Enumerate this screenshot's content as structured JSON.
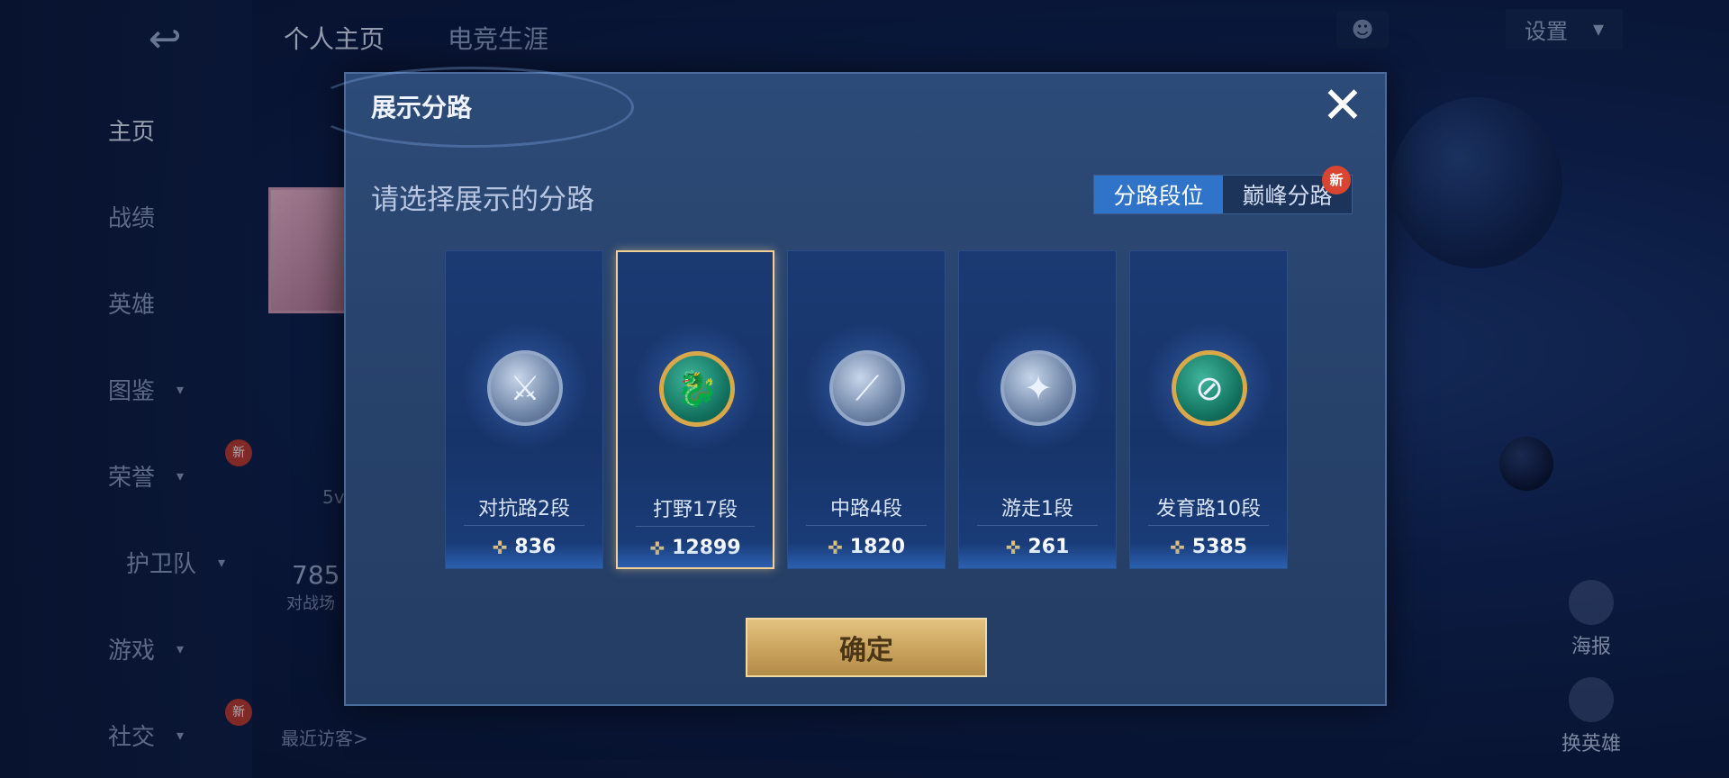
{
  "background": {
    "back_icon": "↩",
    "top_tabs": [
      "个人主页",
      "电竞生涯"
    ],
    "settings_label": "设置",
    "nav": [
      {
        "label": "主页",
        "chevron": false,
        "new": false
      },
      {
        "label": "战绩",
        "chevron": false,
        "new": false
      },
      {
        "label": "英雄",
        "chevron": false,
        "new": false
      },
      {
        "label": "图鉴",
        "chevron": true,
        "new": false
      },
      {
        "label": "荣誉",
        "chevron": true,
        "new": true
      },
      {
        "label": "护卫队",
        "chevron": true,
        "new": false
      },
      {
        "label": "游戏",
        "chevron": true,
        "new": false
      },
      {
        "label": "社交",
        "chevron": true,
        "new": true
      }
    ],
    "new_tag": "新",
    "recent_visitors_label": "最近访客>",
    "partial_number": "785",
    "partial_label": "对战场",
    "partial_small": "5v",
    "side_buttons": [
      "海报",
      "换英雄"
    ]
  },
  "modal": {
    "title": "展示分路",
    "close_icon": "✕",
    "prompt": "请选择展示的分路",
    "toggle": {
      "options": [
        "分路段位",
        "巅峰分路"
      ],
      "active_index": 0,
      "new_tag": "新"
    },
    "cards": [
      {
        "lane": "对抗路2段",
        "score": "836",
        "badge": "crossed-swords-icon",
        "glyph": "⚔",
        "tier": "silver",
        "selected": false
      },
      {
        "lane": "打野17段",
        "score": "12899",
        "badge": "dragon-icon",
        "glyph": "🐉",
        "tier": "gold",
        "selected": true
      },
      {
        "lane": "中路4段",
        "score": "1820",
        "badge": "wand-icon",
        "glyph": "⟋",
        "tier": "silver",
        "selected": false
      },
      {
        "lane": "游走1段",
        "score": "261",
        "badge": "wings-icon",
        "glyph": "✦",
        "tier": "silver",
        "selected": false
      },
      {
        "lane": "发育路10段",
        "score": "5385",
        "badge": "bow-icon",
        "glyph": "⊘",
        "tier": "gold",
        "selected": false
      }
    ],
    "score_icon": "✜",
    "confirm_label": "确定"
  }
}
